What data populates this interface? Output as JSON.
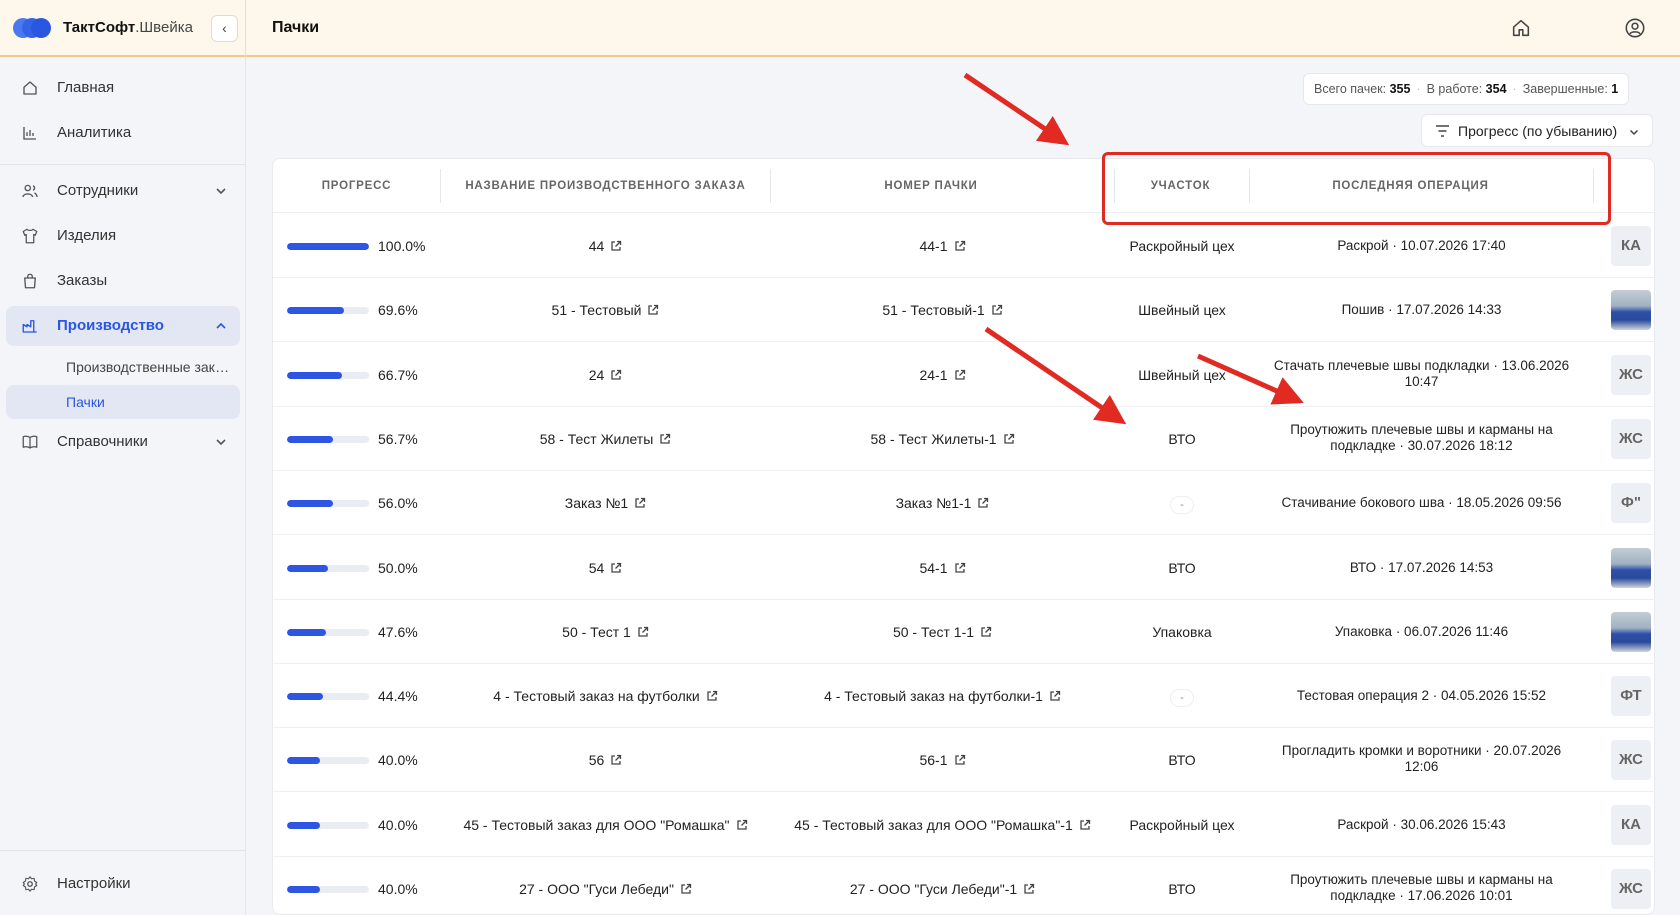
{
  "brand": {
    "name": "ТактСофт",
    "suffix": ".Швейка"
  },
  "header": {
    "title": "Пачки"
  },
  "sidebar": {
    "items": [
      {
        "label": "Главная",
        "icon": "home-icon"
      },
      {
        "label": "Аналитика",
        "icon": "chart-icon"
      },
      {
        "label": "Сотрудники",
        "icon": "users-icon"
      },
      {
        "label": "Изделия",
        "icon": "shirt-icon"
      },
      {
        "label": "Заказы",
        "icon": "bag-icon"
      },
      {
        "label": "Производство",
        "icon": "factory-icon"
      },
      {
        "label": "Справочники",
        "icon": "book-icon"
      }
    ],
    "sub_items": [
      {
        "label": "Производственные заказы"
      },
      {
        "label": "Пачки"
      }
    ],
    "settings_label": "Настройки"
  },
  "stats": {
    "total_label": "Всего пачек:",
    "total_value": "355",
    "in_work_label": "В работе:",
    "in_work_value": "354",
    "done_label": "Завершенные:",
    "done_value": "1"
  },
  "sort": {
    "label": "Прогресс (по убыванию)"
  },
  "table": {
    "columns": [
      "ПРОГРЕСС",
      "НАЗВАНИЕ ПРОИЗВОДСТВЕННОГО ЗАКАЗА",
      "НОМЕР ПАЧКИ",
      "УЧАСТОК",
      "ПОСЛЕДНЯЯ ОПЕРАЦИЯ"
    ],
    "rows": [
      {
        "progress": 100.0,
        "progress_label": "100.0%",
        "order": "44",
        "batch": "44-1",
        "section": "Раскройный цех",
        "op1": "Раскрой · 10.07.2026 17:40",
        "op2": "",
        "avatar": "КА",
        "photo": false
      },
      {
        "progress": 69.6,
        "progress_label": "69.6%",
        "order": "51 - Тестовый",
        "batch": "51 - Тестовый-1",
        "section": "Швейный цех",
        "op1": "Пошив · 17.07.2026 14:33",
        "op2": "",
        "avatar": "",
        "photo": true
      },
      {
        "progress": 66.7,
        "progress_label": "66.7%",
        "order": "24",
        "batch": "24-1",
        "section": "Швейный цех",
        "op1": "Стачать плечевые швы подкладки · 13.06.2026",
        "op2": "10:47",
        "avatar": "ЖС",
        "photo": false
      },
      {
        "progress": 56.7,
        "progress_label": "56.7%",
        "order": "58 - Тест Жилеты",
        "batch": "58 - Тест Жилеты-1",
        "section": "ВТО",
        "op1": "Проутюжить плечевые швы и карманы на",
        "op2": "подкладке · 30.07.2026 18:12",
        "avatar": "ЖС",
        "photo": false
      },
      {
        "progress": 56.0,
        "progress_label": "56.0%",
        "order": "Заказ №1",
        "batch": "Заказ №1-1",
        "section": "-",
        "op1": "Стачивание бокового шва · 18.05.2026 09:56",
        "op2": "",
        "avatar": "Ф\"",
        "photo": false
      },
      {
        "progress": 50.0,
        "progress_label": "50.0%",
        "order": "54",
        "batch": "54-1",
        "section": "ВТО",
        "op1": "ВТО · 17.07.2026 14:53",
        "op2": "",
        "avatar": "",
        "photo": true
      },
      {
        "progress": 47.6,
        "progress_label": "47.6%",
        "order": "50 - Тест 1",
        "batch": "50 - Тест 1-1",
        "section": "Упаковка",
        "op1": "Упаковка · 06.07.2026 11:46",
        "op2": "",
        "avatar": "",
        "photo": true
      },
      {
        "progress": 44.4,
        "progress_label": "44.4%",
        "order": "4 - Тестовый заказ на футболки",
        "batch": "4 - Тестовый заказ на футболки-1",
        "section": "-",
        "op1": "Тестовая операция 2 · 04.05.2026 15:52",
        "op2": "",
        "avatar": "ФТ",
        "photo": false
      },
      {
        "progress": 40.0,
        "progress_label": "40.0%",
        "order": "56",
        "batch": "56-1",
        "section": "ВТО",
        "op1": "Прогладить кромки и воротники · 20.07.2026",
        "op2": "12:06",
        "avatar": "ЖС",
        "photo": false
      },
      {
        "progress": 40.0,
        "progress_label": "40.0%",
        "order": "45 - Тестовый заказ для ООО \"Ромашка\"",
        "batch": "45 - Тестовый заказ для ООО \"Ромашка\"-1",
        "section": "Раскройный цех",
        "op1": "Раскрой · 30.06.2026 15:43",
        "op2": "",
        "avatar": "КА",
        "photo": false
      },
      {
        "progress": 40.0,
        "progress_label": "40.0%",
        "order": "27 - ООО \"Гуси Лебеди\"",
        "batch": "27 - ООО \"Гуси Лебеди\"-1",
        "section": "ВТО",
        "op1": "Проутюжить плечевые швы и карманы на",
        "op2": "подкладке · 17.06.2026 10:01",
        "avatar": "ЖС",
        "photo": false
      }
    ]
  },
  "colors": {
    "accent": "#2a57e0",
    "progress_fill": "#2f55e4",
    "annotation": "#e02a22",
    "topbar_bg": "#fdf7ec"
  }
}
